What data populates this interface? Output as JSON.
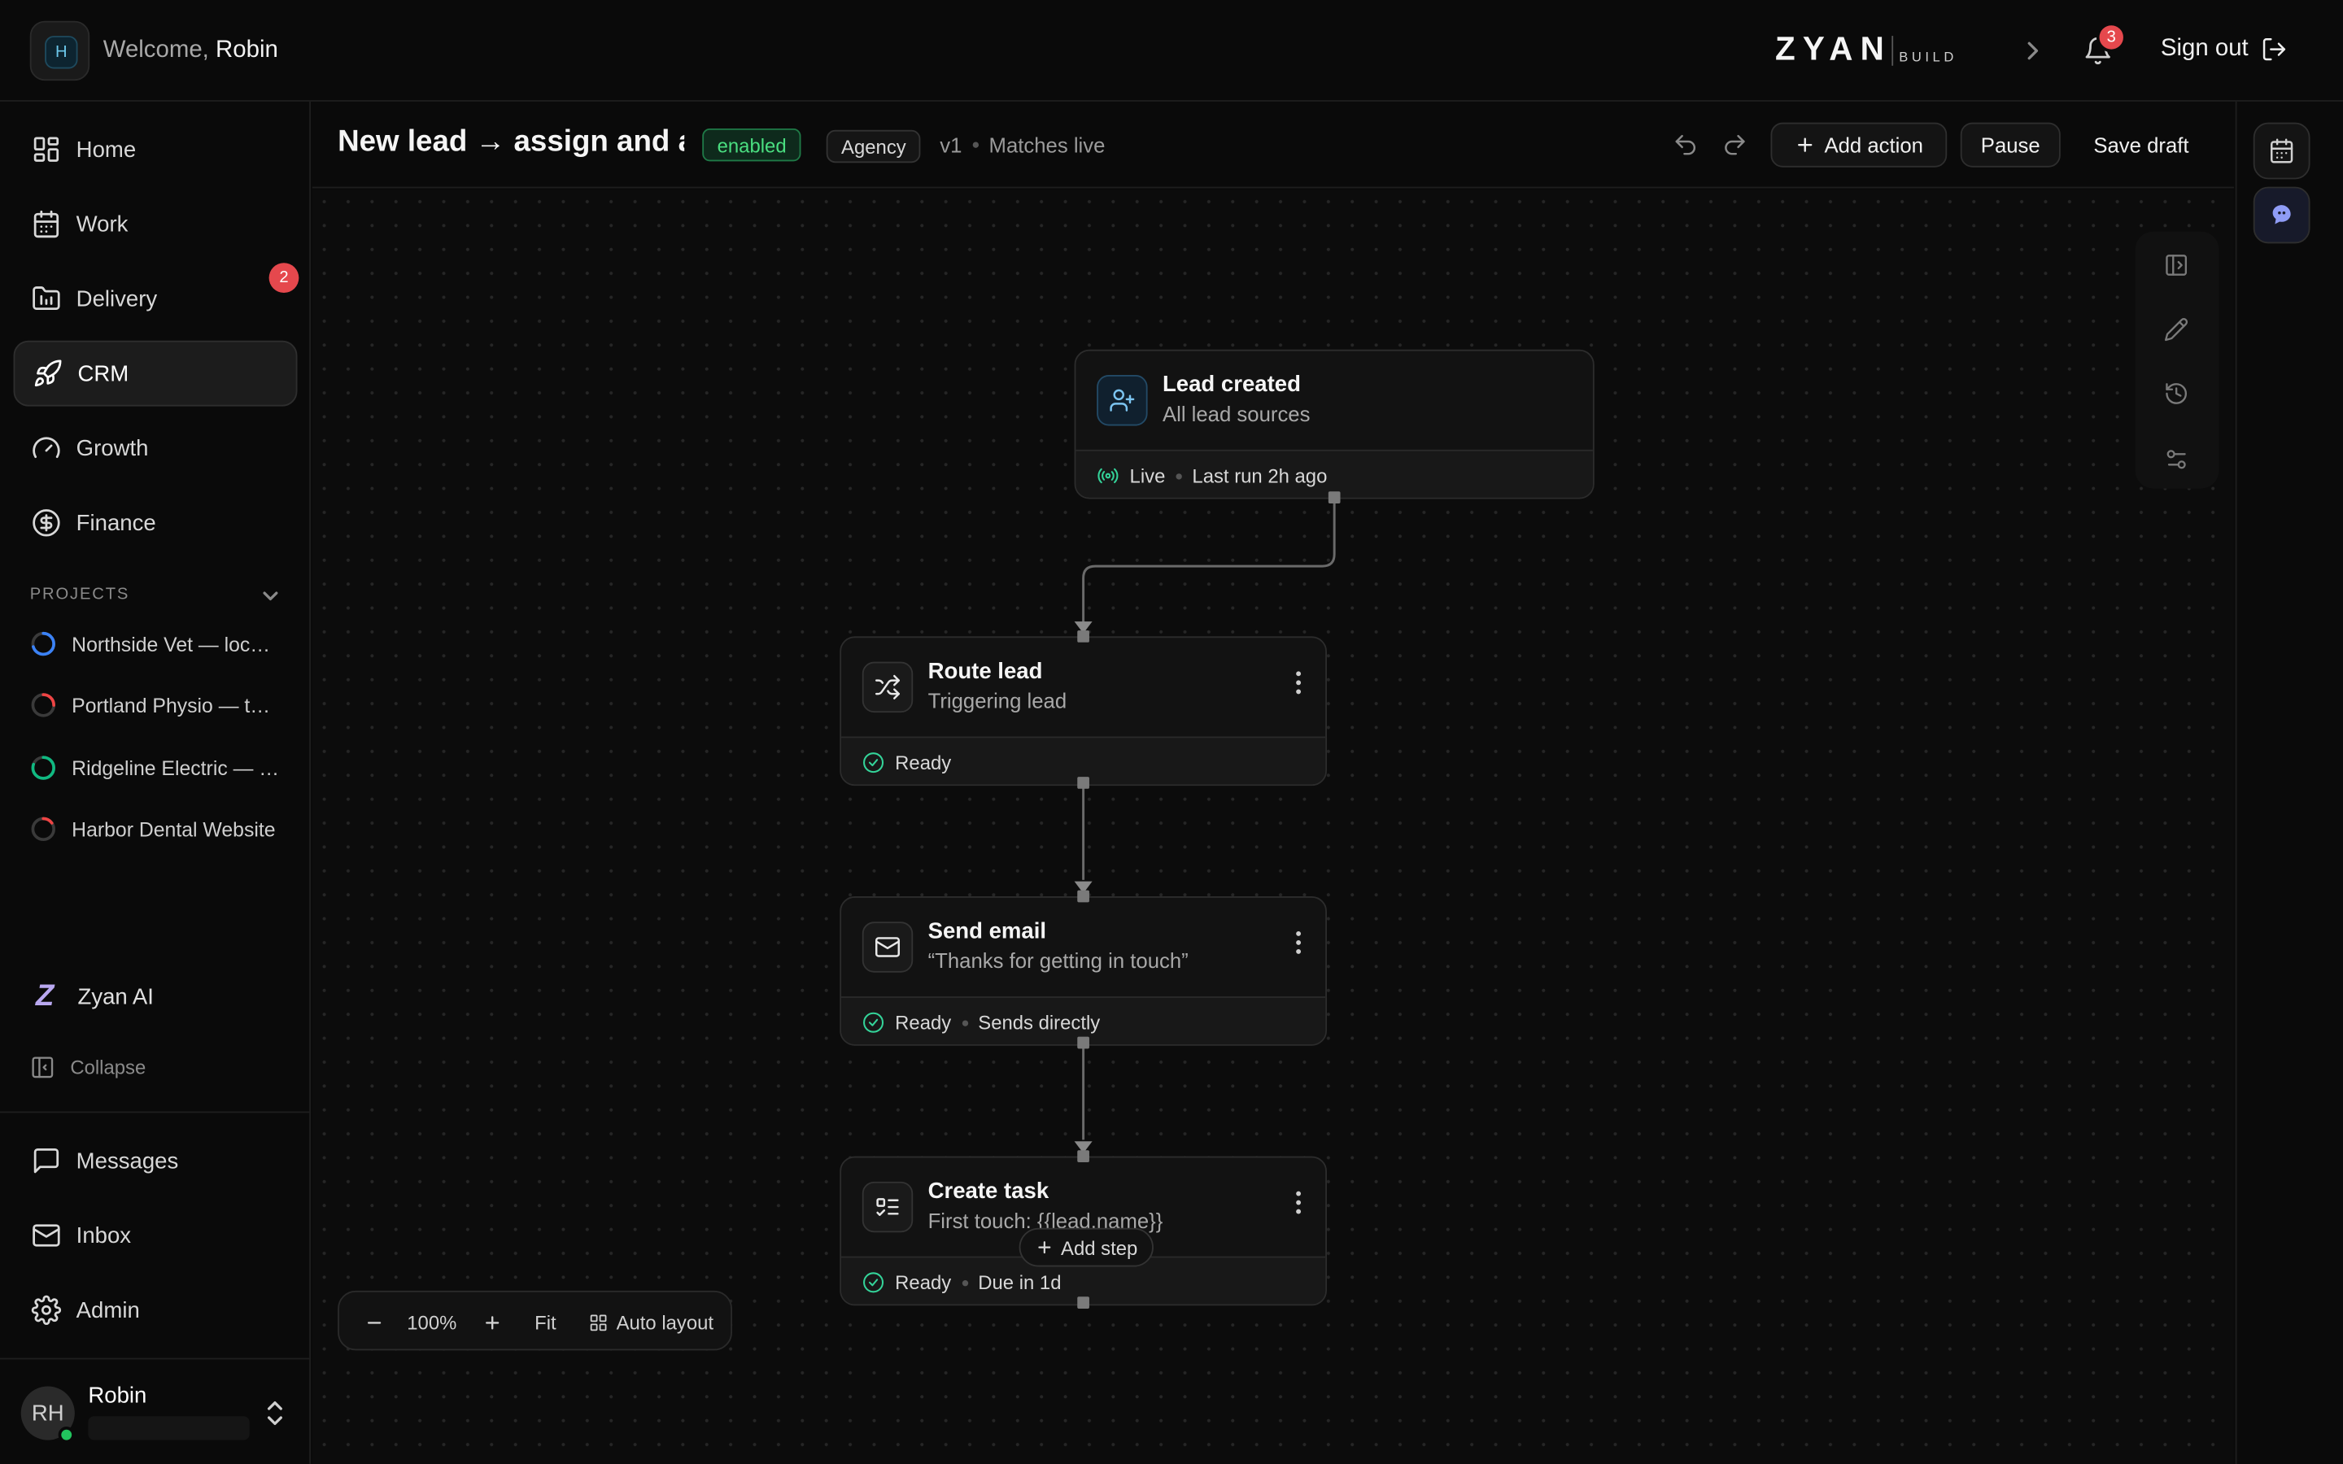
{
  "header": {
    "org_initial": "H",
    "welcome_prefix": "Welcome,",
    "welcome_name": "Robin",
    "brand_word": "ZYAN",
    "brand_sub": "BUILD",
    "notification_count": "3",
    "sign_out": "Sign out"
  },
  "sidebar": {
    "nav": [
      {
        "label": "Home",
        "icon": "grid-icon"
      },
      {
        "label": "Work",
        "icon": "calendar-icon"
      },
      {
        "label": "Delivery",
        "icon": "chart-folder-icon",
        "badge": "2"
      },
      {
        "label": "CRM",
        "icon": "rocket-icon",
        "active": true
      },
      {
        "label": "Growth",
        "icon": "gauge-icon"
      },
      {
        "label": "Finance",
        "icon": "dollar-circle-icon"
      }
    ],
    "projects_label": "PROJECTS",
    "projects": [
      {
        "name": "Northside Vet — local SEO",
        "color": "#3b82f6",
        "progress": 0.7
      },
      {
        "name": "Portland Physio — team",
        "color": "#ef4444",
        "progress": 0.25
      },
      {
        "name": "Ridgeline Electric — site",
        "color": "#10b981",
        "progress": 0.8
      },
      {
        "name": "Harbor Dental Website",
        "color": "#ef4444",
        "progress": 0.15
      }
    ],
    "zyan_ai": "Zyan AI",
    "collapse": "Collapse",
    "bottom_nav": [
      {
        "label": "Messages",
        "icon": "chat-icon"
      },
      {
        "label": "Inbox",
        "icon": "mail-icon"
      },
      {
        "label": "Admin",
        "icon": "gear-icon"
      }
    ],
    "user": {
      "initials": "RH",
      "name": "Robin"
    }
  },
  "toolbar": {
    "title": "New lead → assign and auto-reply",
    "status": "enabled",
    "tag": "Agency",
    "version": "v1",
    "sync": "Matches live",
    "add_action": "Add action",
    "pause": "Pause",
    "save_draft": "Save draft"
  },
  "nodes": [
    {
      "title": "Lead created",
      "subtitle": "All lead sources",
      "status": "Live",
      "meta": "Last run 2h ago"
    },
    {
      "title": "Route lead",
      "subtitle": "Triggering lead",
      "status": "Ready",
      "meta": ""
    },
    {
      "title": "Send email",
      "subtitle": "“Thanks for getting in touch”",
      "status": "Ready",
      "meta": "Sends directly"
    },
    {
      "title": "Create task",
      "subtitle": "First touch: {{lead.name}}",
      "status": "Ready",
      "meta": "Due in 1d"
    }
  ],
  "add_step": "Add step",
  "zoom": {
    "level": "100%",
    "fit": "Fit",
    "auto_layout": "Auto layout"
  },
  "colors": {
    "accent_green": "#4ade80",
    "badge_red": "#e5484d",
    "ai_purple": "#8f9cf5"
  }
}
